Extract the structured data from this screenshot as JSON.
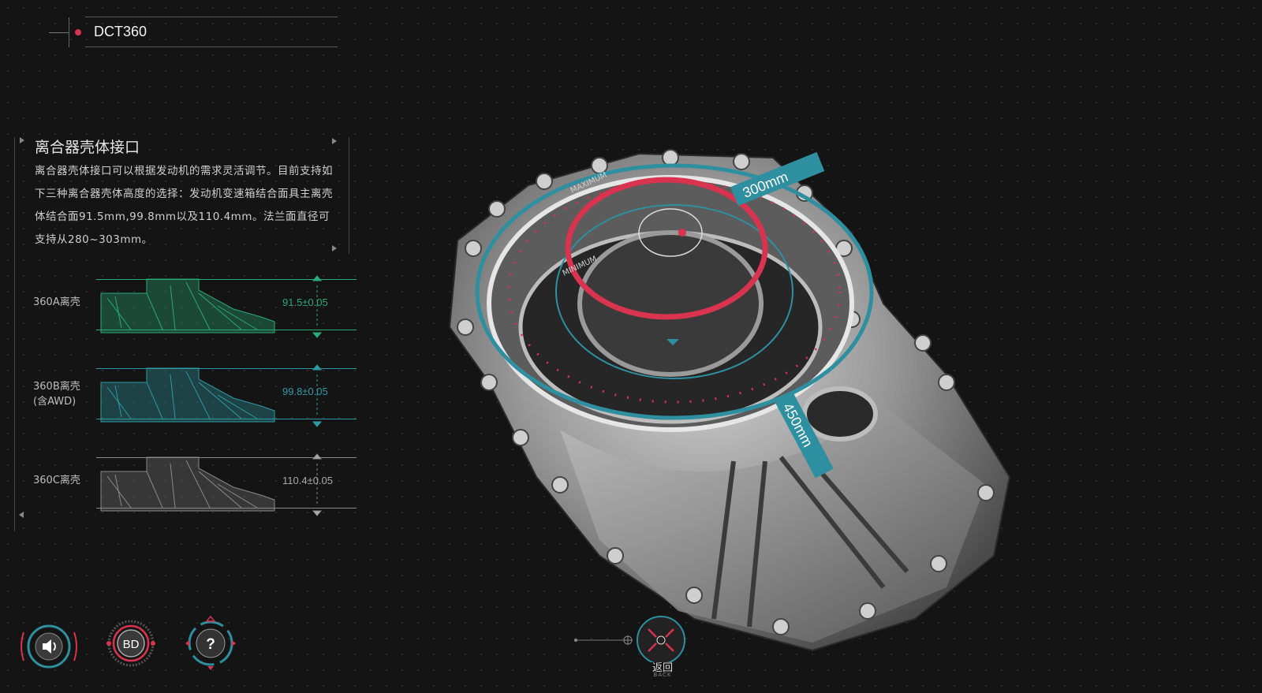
{
  "app": {
    "title": "DCT360"
  },
  "panel": {
    "title": "离合器壳体接口",
    "body": "离合器壳体接口可以根据发动机的需求灵活调节。目前支持如下三种离合器壳体高度的选择：发动机变速箱结合面具主离壳体结合面91.5mm,99.8mm以及110.4mm。法兰面直径可支持从280~303mm。",
    "variants": [
      {
        "label": "360A离壳",
        "value": "91.5±0.05",
        "color": "#2aa97a"
      },
      {
        "label": "360B离壳\n(含AWD)",
        "value": "99.8±0.05",
        "color": "#2e9aa6"
      },
      {
        "label": "360C离壳",
        "value": "110.4±0.05",
        "color": "#8a8a8a"
      }
    ]
  },
  "model": {
    "callout_diameter": "300mm",
    "callout_height": "450mm",
    "ring_label_max": "MAXIMUM",
    "ring_label_min": "MINIMUM"
  },
  "controls": {
    "sound_icon": "speaker-icon",
    "bd_label": "BD",
    "help_label": "?",
    "back_label": "返回",
    "back_sub": "BACK"
  },
  "colors": {
    "accent_red": "#d8334f",
    "accent_teal": "#2e8fa0",
    "variant_green": "#2aa97a",
    "variant_teal": "#2e9aa6",
    "variant_gray": "#8a8a8a"
  }
}
